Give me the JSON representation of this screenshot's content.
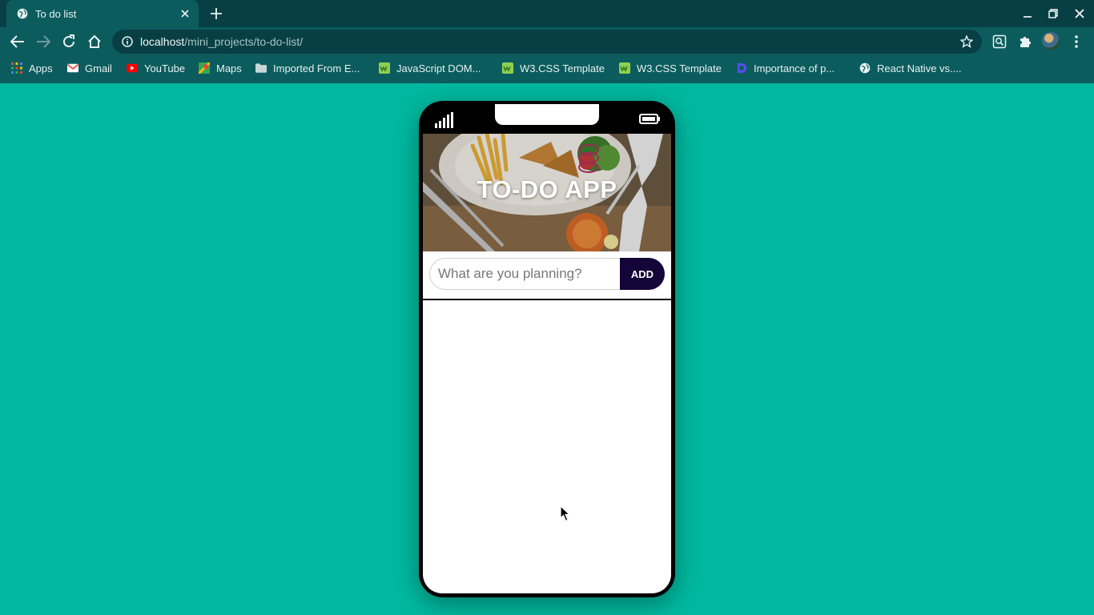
{
  "browser": {
    "tab": {
      "title": "To do list"
    },
    "url": {
      "host": "localhost",
      "path": "/mini_projects/to-do-list/"
    },
    "bookmarks": [
      {
        "label": "Apps",
        "icon": "apps-grid-icon"
      },
      {
        "label": "Gmail",
        "icon": "gmail-icon"
      },
      {
        "label": "YouTube",
        "icon": "youtube-icon"
      },
      {
        "label": "Maps",
        "icon": "maps-icon"
      },
      {
        "label": "Imported From E...",
        "icon": "folder-icon"
      },
      {
        "label": "JavaScript DOM...",
        "icon": "w3-icon"
      },
      {
        "label": "W3.CSS Template",
        "icon": "w3-icon"
      },
      {
        "label": "W3.CSS Template",
        "icon": "w3-icon"
      },
      {
        "label": "Importance of p...",
        "icon": "dev-icon"
      },
      {
        "label": "React Native vs....",
        "icon": "globe-icon"
      }
    ]
  },
  "app": {
    "title": "TO-DO APP",
    "input": {
      "placeholder": "What are you planning?",
      "value": ""
    },
    "add_label": "ADD",
    "items": []
  },
  "colors": {
    "page_background": "#00b89f",
    "add_button": "#150438",
    "chrome_dark": "#083f44",
    "chrome": "#0c5c5e"
  }
}
